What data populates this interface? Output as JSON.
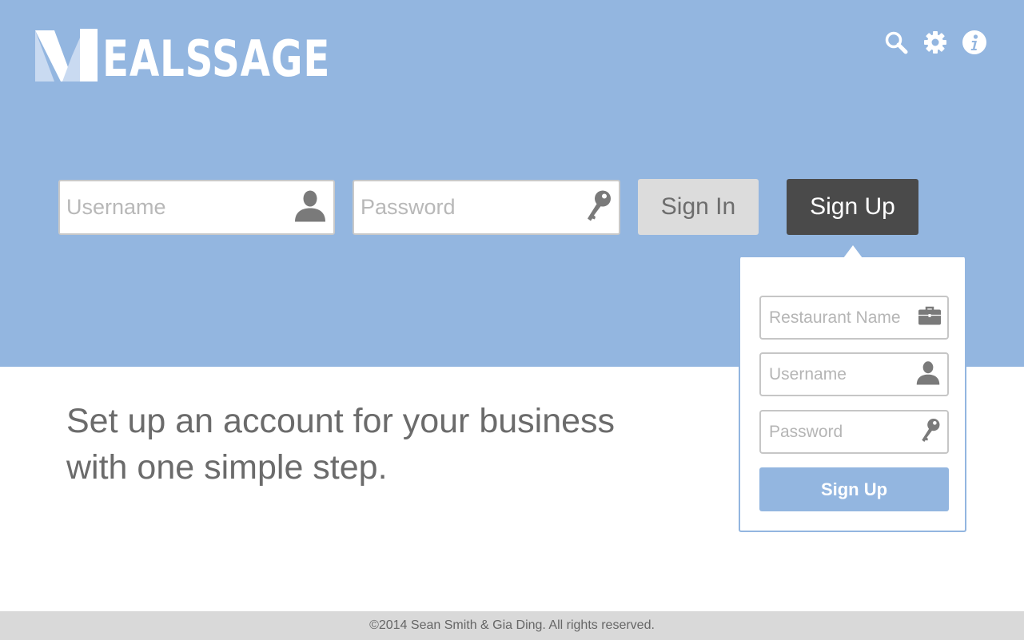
{
  "brand": {
    "logo_text": "MEALSSAGE",
    "logo_wordmark_rest": "EALSSAGE"
  },
  "header": {
    "icons": [
      "search-icon",
      "gear-icon",
      "info-icon"
    ]
  },
  "signin": {
    "username_placeholder": "Username",
    "password_placeholder": "Password",
    "signin_label": "Sign In",
    "signup_label": "Sign Up"
  },
  "main": {
    "tagline": "Set up an account for your business with one simple step."
  },
  "signup_popover": {
    "restaurant_placeholder": "Restaurant Name",
    "username_placeholder": "Username",
    "password_placeholder": "Password",
    "submit_label": "Sign Up"
  },
  "footer": {
    "copyright": "©2014 Sean Smith & Gia Ding. All rights reserved."
  },
  "colors": {
    "hero": "#93b6e0",
    "dark_button": "#4a4a4a",
    "light_button": "#dcdcdc",
    "text_gray": "#6b6b6b",
    "footer_bg": "#d9d9d9"
  }
}
